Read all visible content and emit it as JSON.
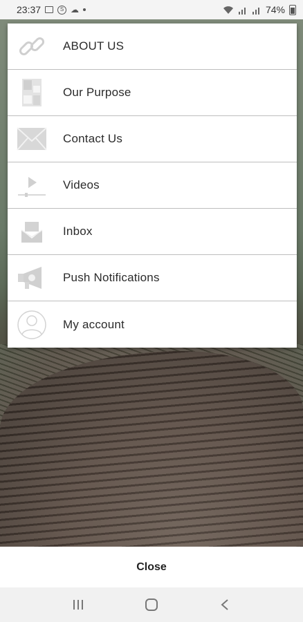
{
  "status_bar": {
    "time": "23:37",
    "battery": "74%",
    "icons": [
      "image-icon",
      "s-circle-icon",
      "cloud-icon",
      "dot-icon",
      "wifi-icon",
      "signal-icon",
      "signal-icon",
      "battery-icon"
    ]
  },
  "menu": {
    "items": [
      {
        "label": "ABOUT US",
        "icon": "link-icon"
      },
      {
        "label": "Our Purpose",
        "icon": "blocks-icon"
      },
      {
        "label": "Contact Us",
        "icon": "envelope-icon"
      },
      {
        "label": "Videos",
        "icon": "play-icon"
      },
      {
        "label": "Inbox",
        "icon": "inbox-icon"
      },
      {
        "label": "Push Notifications",
        "icon": "megaphone-icon"
      },
      {
        "label": "My account",
        "icon": "user-icon"
      }
    ]
  },
  "close_label": "Close",
  "nav": [
    "recents-icon",
    "home-icon",
    "back-icon"
  ]
}
